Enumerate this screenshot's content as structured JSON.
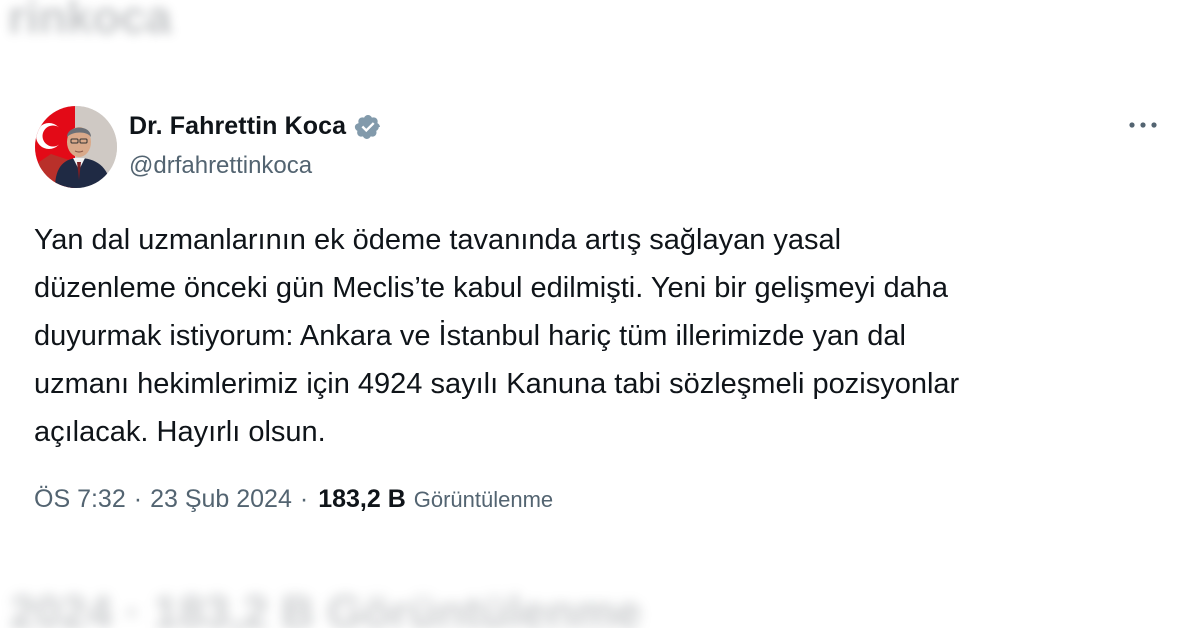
{
  "background": {
    "top_blurred_text": "rinkoca",
    "bottom_blurred_text": "2024 · 183,2 B Görüntülenme"
  },
  "tweet": {
    "author": {
      "display_name": "Dr. Fahrettin Koca",
      "handle": "@drfahrettinkoca",
      "verified": true
    },
    "text": "Yan dal uzmanlarının ek ödeme tavanında artış sağlayan yasal\ndüzenleme önceki gün Meclis’te kabul edilmişti. Yeni bir gelişmeyi daha\nduyurmak istiyorum: Ankara ve İstanbul hariç tüm illerimizde yan dal\nuzmanı hekimlerimiz için 4924 sayılı Kanuna tabi sözleşmeli pozisyonlar\naçılacak. Hayırlı olsun.",
    "time": "ÖS 7:32",
    "separator": "·",
    "date": "23 Şub 2024",
    "views_count": "183,2 B",
    "views_label": "Görüntülenme"
  },
  "icons": {
    "verified": "verified-badge-icon",
    "more": "more-horizontal-icon"
  },
  "colors": {
    "text_primary": "#0f1419",
    "text_secondary": "#536471",
    "verified_badge": "#829aab",
    "flag_red": "#e30a17"
  }
}
